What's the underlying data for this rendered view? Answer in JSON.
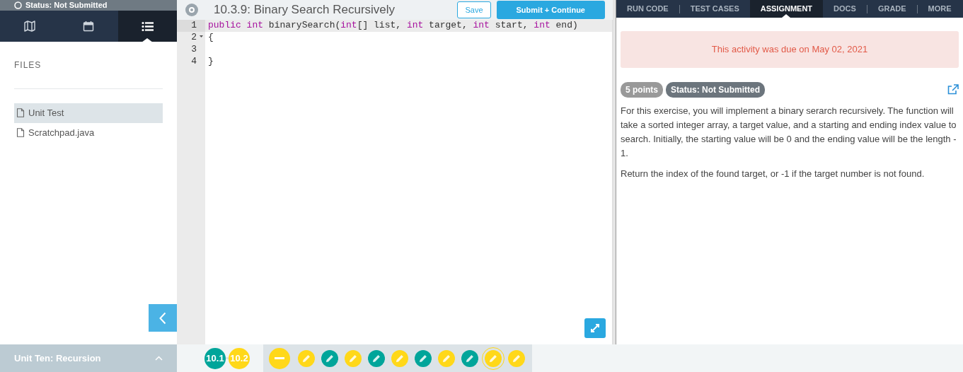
{
  "sidebar": {
    "status": "Status: Not Submitted",
    "view_tabs": [
      {
        "selected": false
      },
      {
        "selected": false
      },
      {
        "selected": true
      }
    ],
    "files_heading": "FILES",
    "files": [
      {
        "name": "Unit Test",
        "selected": true
      },
      {
        "name": "Scratchpad.java",
        "selected": false
      }
    ],
    "unit": "Unit Ten: Recursion"
  },
  "editor": {
    "title": "10.3.9: Binary Search Recursively",
    "buttons": [
      {
        "label": "Save",
        "kind": "outline"
      },
      {
        "label": "Submit + Continue",
        "kind": "primary"
      }
    ],
    "lines": [
      {
        "number": "1",
        "active": true,
        "foldable": false,
        "tokens": [
          {
            "text": "public",
            "kind": "keyword"
          },
          {
            "text": " int",
            "kind": "keyword"
          },
          {
            "text": " binarySearch(",
            "kind": "plain"
          },
          {
            "text": "int",
            "kind": "keyword"
          },
          {
            "text": "[] list, ",
            "kind": "plain"
          },
          {
            "text": "int",
            "kind": "keyword"
          },
          {
            "text": " target, ",
            "kind": "plain"
          },
          {
            "text": "int",
            "kind": "keyword"
          },
          {
            "text": " start, ",
            "kind": "plain"
          },
          {
            "text": "int",
            "kind": "keyword"
          },
          {
            "text": " end)",
            "kind": "plain"
          }
        ]
      },
      {
        "number": "2",
        "active": false,
        "foldable": true,
        "tokens": [
          {
            "text": "{",
            "kind": "plain"
          }
        ]
      },
      {
        "number": "3",
        "active": false,
        "foldable": false
      },
      {
        "number": "4",
        "active": false,
        "foldable": false,
        "tokens": [
          {
            "text": "}",
            "kind": "plain"
          }
        ]
      }
    ]
  },
  "panel": {
    "tabs": [
      {
        "label": "RUN CODE",
        "selected": false
      },
      {
        "label": "TEST CASES",
        "selected": false
      },
      {
        "label": "ASSIGNMENT",
        "selected": true
      },
      {
        "label": "DOCS",
        "selected": false
      },
      {
        "label": "GRADE",
        "selected": false
      },
      {
        "label": "MORE",
        "selected": false
      }
    ],
    "alert": "This activity was due on May 02, 2021",
    "badges": [
      {
        "text": "5 points",
        "kind": "light"
      },
      {
        "text": "Status: Not Submitted",
        "kind": "dark"
      }
    ],
    "paragraphs": [
      "For this exercise, you will implement a binary serarch recursively. The function will take a sorted integer array, a target value, and a starting and ending index value to search. Initially, the starting value will be 0 and the ending value will be the length - 1.",
      "Return the index of the found target, or -1 if the target number is not found."
    ]
  },
  "progress": {
    "units": [
      {
        "label": "10.1",
        "color": "#00a59a"
      },
      {
        "label": "10.2",
        "color": "#ffd819"
      }
    ],
    "items": [
      {
        "kind": "minus",
        "color": "#ffd819",
        "selected": false
      },
      {
        "kind": "pencil",
        "color": "#ffd819",
        "selected": false
      },
      {
        "kind": "pencil",
        "color": "#00a59a",
        "selected": false
      },
      {
        "kind": "pencil",
        "color": "#ffd819",
        "selected": false
      },
      {
        "kind": "pencil",
        "color": "#00a59a",
        "selected": false
      },
      {
        "kind": "pencil",
        "color": "#ffd819",
        "selected": false
      },
      {
        "kind": "pencil",
        "color": "#00a59a",
        "selected": false
      },
      {
        "kind": "pencil",
        "color": "#ffd819",
        "selected": false
      },
      {
        "kind": "pencil",
        "color": "#00a59a",
        "selected": false
      },
      {
        "kind": "pencil",
        "color": "#ffd819",
        "selected": true
      },
      {
        "kind": "pencil",
        "color": "#ffd819",
        "selected": false
      }
    ]
  }
}
